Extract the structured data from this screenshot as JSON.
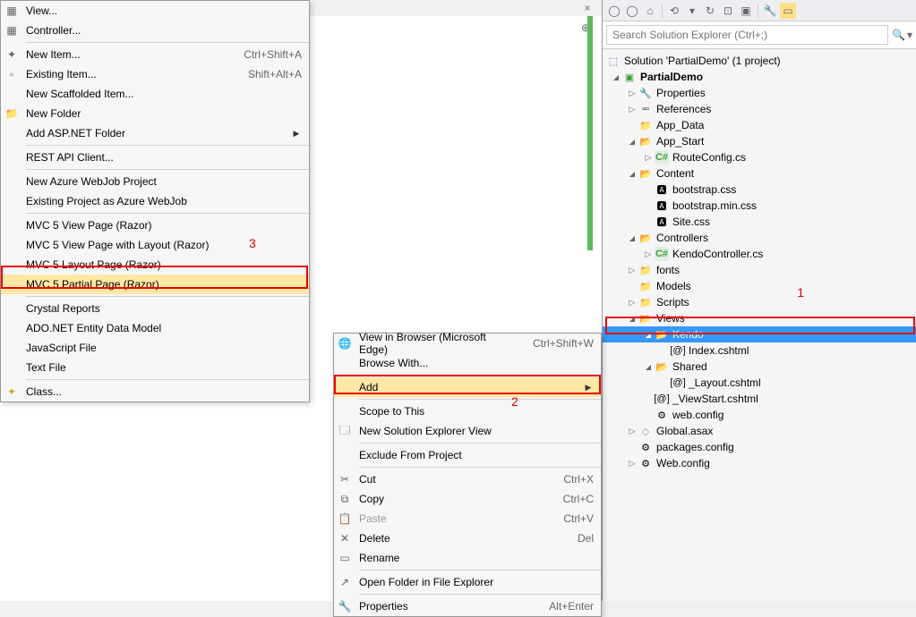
{
  "search_placeholder": "Search Solution Explorer (Ctrl+;)",
  "solution_title": "Solution 'PartialDemo' (1 project)",
  "project_name": "PartialDemo",
  "tree": {
    "properties": "Properties",
    "references": "References",
    "app_data": "App_Data",
    "app_start": "App_Start",
    "route_config": "RouteConfig.cs",
    "content": "Content",
    "bootstrap_css": "bootstrap.css",
    "bootstrap_min_css": "bootstrap.min.css",
    "site_css": "Site.css",
    "controllers": "Controllers",
    "kendo_controller": "KendoController.cs",
    "fonts": "fonts",
    "models": "Models",
    "scripts": "Scripts",
    "views": "Views",
    "kendo": "Kendo",
    "index_cshtml": "Index.cshtml",
    "shared": "Shared",
    "layout_cshtml": "_Layout.cshtml",
    "viewstart_cshtml": "_ViewStart.cshtml",
    "web_config": "web.config",
    "global_asax": "Global.asax",
    "packages_config": "packages.config",
    "web_config2": "Web.config"
  },
  "annotations": {
    "one": "1",
    "two": "2",
    "three": "3"
  },
  "ctx1": {
    "view_browser": "View in Browser (Microsoft Edge)",
    "view_browser_short": "Ctrl+Shift+W",
    "browse_with": "Browse With...",
    "add": "Add",
    "scope": "Scope to This",
    "new_explorer": "New Solution Explorer View",
    "exclude": "Exclude From Project",
    "cut": "Cut",
    "cut_short": "Ctrl+X",
    "copy": "Copy",
    "copy_short": "Ctrl+C",
    "paste": "Paste",
    "paste_short": "Ctrl+V",
    "delete": "Delete",
    "delete_short": "Del",
    "rename": "Rename",
    "open_folder": "Open Folder in File Explorer",
    "properties": "Properties",
    "properties_short": "Alt+Enter"
  },
  "ctx2": {
    "view": "View...",
    "controller": "Controller...",
    "new_item": "New Item...",
    "new_item_short": "Ctrl+Shift+A",
    "existing_item": "Existing Item...",
    "existing_item_short": "Shift+Alt+A",
    "scaffolded": "New Scaffolded Item...",
    "new_folder": "New Folder",
    "asp_folder": "Add ASP.NET Folder",
    "rest_api": "REST API Client...",
    "webjob": "New Azure WebJob Project",
    "existing_webjob": "Existing Project as Azure WebJob",
    "mvc5_view": "MVC 5 View Page (Razor)",
    "mvc5_view_layout": "MVC 5 View Page with Layout (Razor)",
    "mvc5_layout": "MVC 5 Layout Page (Razor)",
    "mvc5_partial": "MVC 5 Partial Page (Razor)",
    "crystal": "Crystal Reports",
    "ado": "ADO.NET Entity Data Model",
    "js_file": "JavaScript File",
    "text_file": "Text File",
    "class": "Class..."
  }
}
